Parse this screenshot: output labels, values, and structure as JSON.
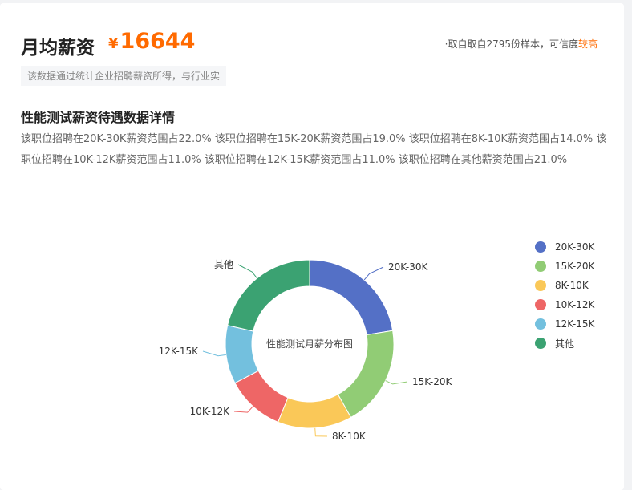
{
  "header": {
    "title": "月均薪资",
    "currency": "¥",
    "salary": "16644",
    "sample_text": "·取自取自2795份样本，可信度",
    "confidence": "较高",
    "note": "该数据通过统计企业招聘薪资所得，与行业实"
  },
  "section": {
    "title": "性能测试薪资待遇数据详情",
    "description": "该职位招聘在20K-30K薪资范围占22.0% 该职位招聘在15K-20K薪资范围占19.0% 该职位招聘在8K-10K薪资范围占14.0% 该职位招聘在10K-12K薪资范围占11.0% 该职位招聘在12K-15K薪资范围占11.0% 该职位招聘在其他薪资范围占21.0%"
  },
  "colors": {
    "accent": "#ff6a00"
  },
  "chart_data": {
    "type": "pie",
    "donut": true,
    "center_label": "性能测试月薪分布图",
    "legend_position": "right",
    "categories": [
      "20K-30K",
      "15K-20K",
      "8K-10K",
      "10K-12K",
      "12K-15K",
      "其他"
    ],
    "values": [
      22.0,
      19.0,
      14.0,
      11.0,
      11.0,
      21.0
    ],
    "colors": [
      "#5470c6",
      "#91cc75",
      "#fac858",
      "#ee6666",
      "#73c0de",
      "#3ba272"
    ]
  }
}
